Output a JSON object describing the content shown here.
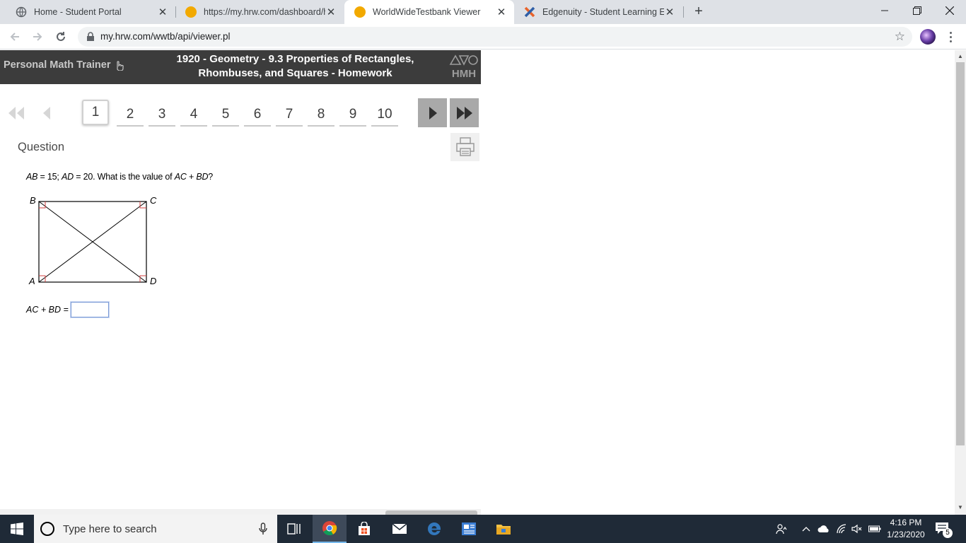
{
  "browser": {
    "tabs": [
      {
        "title": "Home - Student Portal",
        "active": false
      },
      {
        "title": "https://my.hrw.com/dashboard/h",
        "active": false
      },
      {
        "title": "WorldWideTestbank Viewer",
        "active": true
      },
      {
        "title": "Edgenuity - Student Learning Exp",
        "active": false
      }
    ],
    "url": "my.hrw.com/wwtb/api/viewer.pl"
  },
  "header": {
    "brand": "Personal Math Trainer",
    "title_line1": "1920 - Geometry - 9.3 Properties of Rectangles,",
    "title_line2": "Rhombuses, and Squares - Homework",
    "logo_text": "HMH"
  },
  "pager": {
    "pages": [
      "1",
      "2",
      "3",
      "4",
      "5",
      "6",
      "7",
      "8",
      "9",
      "10"
    ],
    "current": "1"
  },
  "question": {
    "heading": "Question",
    "text_var1": "AB",
    "text_part1": " = 15; ",
    "text_var2": "AD",
    "text_part2": " = 20. What is the value of ",
    "text_var3": "AC",
    "text_part3": " + ",
    "text_var4": "BD",
    "text_part4": "?",
    "vertices": {
      "A": "A",
      "B": "B",
      "C": "C",
      "D": "D"
    },
    "answer_label": "AC + BD =",
    "answer_value": ""
  },
  "taskbar": {
    "search_placeholder": "Type here to search",
    "time": "4:16 PM",
    "date": "1/23/2020",
    "notification_count": "5"
  },
  "colors": {
    "header_bg": "#3c3c3c",
    "right_angle_marks": "#d04040",
    "taskbar_bg": "#1f2a37"
  }
}
